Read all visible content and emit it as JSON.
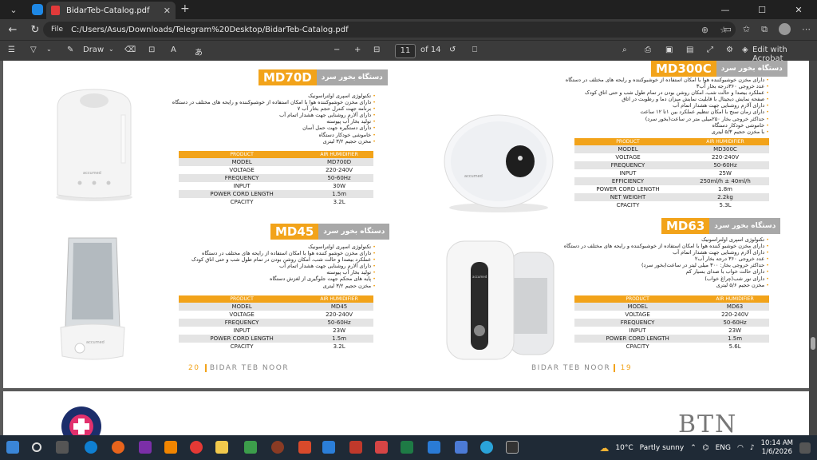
{
  "browser": {
    "tab_title": "BidarTeb-Catalog.pdf",
    "url_prefix": "File",
    "url": "C:/Users/Asus/Downloads/Telegram%20Desktop/BidarTeb-Catalog.pdf"
  },
  "pdf_toolbar": {
    "draw_label": "Draw",
    "page_current": "11",
    "page_total": "of 14",
    "edit_acrobat": "Edit with Acrobat"
  },
  "page": {
    "left": {
      "products": [
        {
          "model": "MD70D",
          "title_fa": "دستگاه بخور سرد",
          "features": [
            "تکنولوژی اسپری اولتراسونیک",
            "دارای مخزن خوشبوکننده هوا با امکان استفاده از خوشبوکننده و رایحه های مختلف در دستگاه",
            "۷ برنامه جهت کنترل حجم بخار آب",
            "دارای آلارم روشنایی جهت هشدار اتمام آب",
            "تولید بخار آب پیوسته",
            "دارای دستگیره جهت حمل آسان",
            "خاموشی خودکار دستگاه",
            "مخزن حجیم ۳/۲ لیتری"
          ],
          "specs": [
            [
              "PRODUCT",
              "AIR HUMIDIFIER"
            ],
            [
              "MODEL",
              "MD700D"
            ],
            [
              "VOLTAGE",
              "220-240V"
            ],
            [
              "FREQUENCY",
              "50-60Hz"
            ],
            [
              "INPUT",
              "30W"
            ],
            [
              "POWER CORD LENGTH",
              "1.5m"
            ],
            [
              "CPACITY",
              "3.2L"
            ]
          ],
          "brand": "accumed"
        },
        {
          "model": "MD45",
          "title_fa": "دستگاه بخور سرد",
          "features": [
            "تکنولوژی اسپری اولتراسونیک",
            "دارای مخزن خوشبو کننده هوا با امکان استفاده از رایحه های مختلف در دستگاه",
            "عملکرد بیصدا و حالت شب، امکان روشن بودن در تمام طول شب و حتی اتاق کودک",
            "دارای آلارم روشنایی جهت هشدار اتمام آب",
            "تولید بخار آب پیوسته",
            "پایه های محکم جهت جلوگیری از لغزش دستگاه",
            "مخزن حجیم ۳/۲ لیتری"
          ],
          "specs": [
            [
              "PRODUCT",
              "AIR HUMIDIFIER"
            ],
            [
              "MODEL",
              "MD45"
            ],
            [
              "VOLTAGE",
              "220-240V"
            ],
            [
              "FREQUENCY",
              "50-60Hz"
            ],
            [
              "INPUT",
              "23W"
            ],
            [
              "POWER CORD LENGTH",
              "1.5m"
            ],
            [
              "CPACITY",
              "3.2L"
            ]
          ],
          "brand": "accumed"
        }
      ],
      "footer_num": "20",
      "footer_text": "BIDAR TEB NOOR"
    },
    "right": {
      "products": [
        {
          "model": "MD300C",
          "title_fa": "دستگاه بخور سرد",
          "features": [
            "دارای مخزن خوشبوکننده هوا با امکان استفاده از خوشبوکننده و رایحه های مختلف در دستگاه",
            "۳عدد خروجی ۳۶۰درجه بخار آب",
            "عملکرد بیصدا و حالت شب، امکان روشن بودن در تمام طول شب و حتی اتاق کودک",
            "صفحه نمایش دیجیتال با قابلیت نمایش میزان دما و رطوبت در اتاق",
            "دارای آلارم روشنایی جهت هشدار اتمام آب",
            "دارای زمان سنج با امکان تنظیم عملکرد بین ۱تا ۱۲ ساعت",
            "حداکثر خروجی بخار ۲۵۰میلی متر در ساعت(بخور سرد)",
            "خاموشی خودکار دستگاه",
            "با مخزن حجیم ۵/۳ لیتری"
          ],
          "specs": [
            [
              "PRODUCT",
              "AIR HUMIDIFIER"
            ],
            [
              "MODEL",
              "MD300C"
            ],
            [
              "VOLTAGE",
              "220-240V"
            ],
            [
              "FREQUENCY",
              "50-60Hz"
            ],
            [
              "INPUT",
              "25W"
            ],
            [
              "EFFICIENCY",
              "250ml/h ± 40ml/h"
            ],
            [
              "POWER CORD LENGTH",
              "1.8m"
            ],
            [
              "NET WEIGHT",
              "2.2kg"
            ],
            [
              "CPACITY",
              "5.3L"
            ]
          ],
          "brand": "accumed"
        },
        {
          "model": "MD63",
          "title_fa": "دستگاه بخور سرد",
          "features": [
            "تکنولوژی اسپری اولتراسونیک",
            "دارای مخزن خوشبو کننده هوا با امکان استفاده از خوشبوکننده و رایحه های مختلف در دستگاه",
            "دارای آلارم روشنایی جهت هشدار اتمام آب",
            "۲عدد خروجی ۳۶۰ درجه بخار آب",
            "حداکثر خروجی بخار: ۳۰۰ میلی لیتر در ساعت(بخور سرد)",
            "دارای حالت خواب با صدای بسیار کم",
            "دارای نور شب(چراغ خواب)",
            "مخزن حجیم ۵/۶ لیتری"
          ],
          "specs": [
            [
              "PRODUCT",
              "AIR HUMIDIFIER"
            ],
            [
              "MODEL",
              "MD63"
            ],
            [
              "VOLTAGE",
              "220-240V"
            ],
            [
              "FREQUENCY",
              "50-60Hz"
            ],
            [
              "INPUT",
              "23W"
            ],
            [
              "POWER CORD LENGTH",
              "1.5m"
            ],
            [
              "CPACITY",
              "5.6L"
            ]
          ],
          "brand": "accumed"
        }
      ],
      "footer_num": "19",
      "footer_text": "BIDAR TEB NOOR"
    },
    "next_page_logo": "BTN"
  },
  "taskbar": {
    "weather_temp": "10°C",
    "weather_text": "Partly sunny",
    "lang": "ENG",
    "time": "10:14 AM",
    "date": "1/6/2026"
  }
}
